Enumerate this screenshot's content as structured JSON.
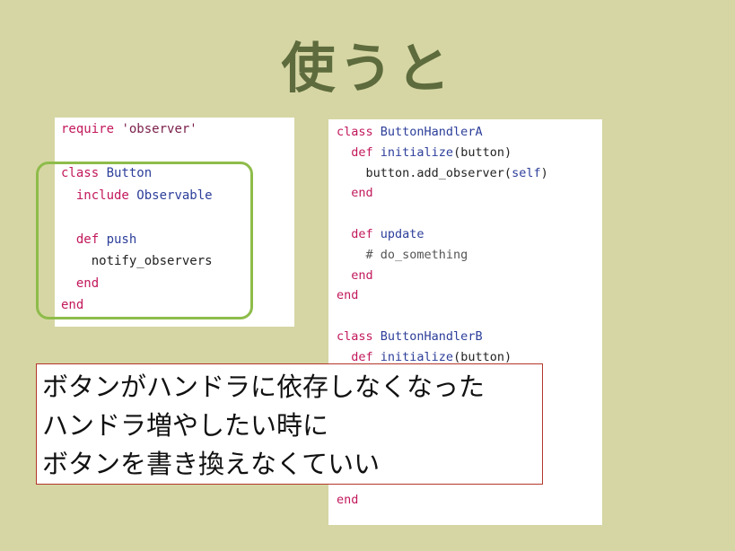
{
  "title": "使うと",
  "left_code": {
    "lines": [
      [
        {
          "t": "require ",
          "c": "kw"
        },
        {
          "t": "'observer'",
          "c": "str"
        }
      ],
      [],
      [
        {
          "t": "class ",
          "c": "kw"
        },
        {
          "t": "Button",
          "c": "nm"
        }
      ],
      [
        {
          "t": "  include ",
          "c": "kw"
        },
        {
          "t": "Observable",
          "c": "nm"
        }
      ],
      [],
      [
        {
          "t": "  def ",
          "c": "kw"
        },
        {
          "t": "push",
          "c": "nm"
        }
      ],
      [
        {
          "t": "    notify_observers",
          "c": "pl"
        }
      ],
      [
        {
          "t": "  end",
          "c": "kw"
        }
      ],
      [
        {
          "t": "end",
          "c": "kw"
        }
      ]
    ]
  },
  "right_code": {
    "lines": [
      [
        {
          "t": "class ",
          "c": "kw"
        },
        {
          "t": "ButtonHandlerA",
          "c": "nm"
        }
      ],
      [
        {
          "t": "  def ",
          "c": "kw"
        },
        {
          "t": "initialize",
          "c": "nm"
        },
        {
          "t": "(button)",
          "c": "pl"
        }
      ],
      [
        {
          "t": "    button.add_observer(",
          "c": "pl"
        },
        {
          "t": "self",
          "c": "nm"
        },
        {
          "t": ")",
          "c": "pl"
        }
      ],
      [
        {
          "t": "  end",
          "c": "kw"
        }
      ],
      [],
      [
        {
          "t": "  def ",
          "c": "kw"
        },
        {
          "t": "update",
          "c": "nm"
        }
      ],
      [
        {
          "t": "    # do_something",
          "c": "cm"
        }
      ],
      [
        {
          "t": "  end",
          "c": "kw"
        }
      ],
      [
        {
          "t": "end",
          "c": "kw"
        }
      ],
      [],
      [
        {
          "t": "class ",
          "c": "kw"
        },
        {
          "t": "ButtonHandlerB",
          "c": "nm"
        }
      ],
      [
        {
          "t": "  def ",
          "c": "kw"
        },
        {
          "t": "initialize",
          "c": "nm"
        },
        {
          "t": "(button)",
          "c": "pl"
        }
      ],
      [
        {
          "t": "                           )",
          "c": "pl"
        }
      ],
      [],
      [],
      [],
      [],
      [],
      [
        {
          "t": "end",
          "c": "kw"
        }
      ]
    ]
  },
  "callout": {
    "lines": [
      "ボタンがハンドラに依存しなくなった",
      "ハンドラ増やしたい時に",
      "ボタンを書き換えなくていい"
    ]
  },
  "colors": {
    "background": "#d6d6a4",
    "title": "#5d6b3d",
    "highlight": "#8ebc4a",
    "callout_border": "#b3362a",
    "keyword": "#c2185b",
    "name": "#2c3e9a"
  }
}
